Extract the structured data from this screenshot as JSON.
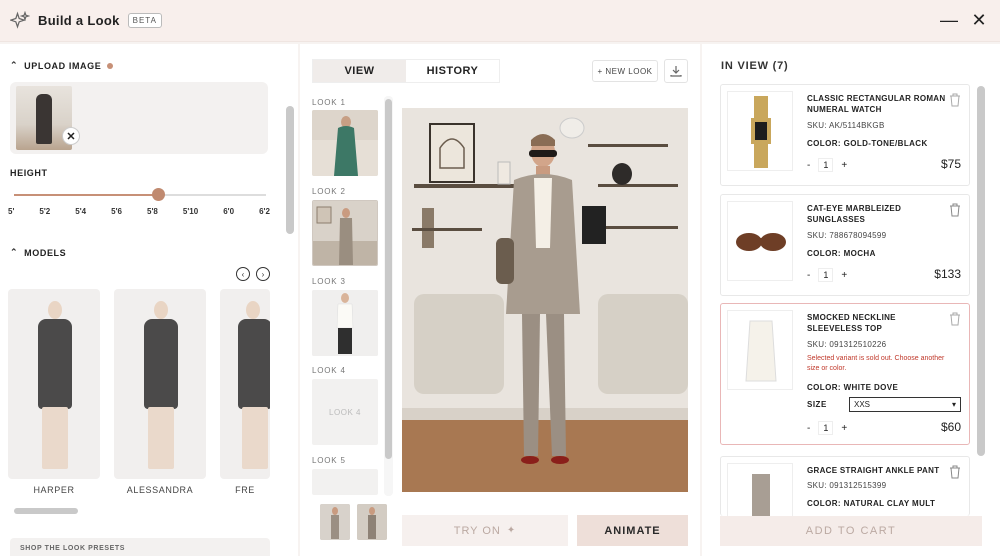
{
  "app": {
    "title": "Build a Look",
    "badge": "BETA"
  },
  "window": {
    "minimize": "—",
    "close": "✕"
  },
  "left": {
    "upload_title": "UPLOAD IMAGE",
    "height_title": "HEIGHT",
    "height_ticks": [
      "5'",
      "5'2",
      "5'4",
      "5'6",
      "5'8",
      "5'10",
      "6'0",
      "6'2"
    ],
    "height_selected": "5'8",
    "height_fraction": 0.57,
    "models_title": "MODELS",
    "models": [
      {
        "name": "HARPER"
      },
      {
        "name": "ALESSANDRA"
      },
      {
        "name": "FRE"
      }
    ],
    "presets_title": "SHOP THE LOOK PRESETS"
  },
  "mid": {
    "tabs": [
      "VIEW",
      "HISTORY"
    ],
    "active_tab": "VIEW",
    "new_look": "+ NEW LOOK",
    "looks": [
      {
        "label": "LOOK 1"
      },
      {
        "label": "LOOK 2"
      },
      {
        "label": "LOOK 3"
      },
      {
        "label": "LOOK 4",
        "placeholder": "LOOK 4"
      },
      {
        "label": "LOOK 5"
      }
    ],
    "try_on": "TRY ON",
    "animate": "ANIMATE"
  },
  "right": {
    "in_view": "IN VIEW (7)",
    "items": [
      {
        "name": "CLASSIC RECTANGULAR ROMAN NUMERAL WATCH",
        "sku": "SKU: AK/5114BKGB",
        "color": "COLOR: GOLD-TONE/BLACK",
        "qty": "1",
        "price": "$75"
      },
      {
        "name": "CAT-EYE MARBLEIZED SUNGLASSES",
        "sku": "SKU: 788678094599",
        "color": "COLOR: MOCHA",
        "qty": "1",
        "price": "$133"
      },
      {
        "name": "SMOCKED NECKLINE SLEEVELESS TOP",
        "sku": "SKU: 091312510226",
        "error": "Selected variant is sold out. Choose another size or color.",
        "color": "COLOR: WHITE DOVE",
        "size_label": "SIZE",
        "size_value": "XXS",
        "qty": "1",
        "price": "$60"
      },
      {
        "name": "GRACE STRAIGHT ANKLE PANT",
        "sku": "SKU: 091312515399",
        "color": "COLOR: NATURAL CLAY MULT"
      }
    ],
    "add_to_cart": "ADD TO CART"
  },
  "colors": {
    "accent": "#c79077",
    "error": "#c0392b",
    "header_bg": "#f8efec"
  },
  "icons": [
    "sparkle-logo-icon",
    "minimize-icon",
    "close-icon",
    "chevron-up-icon",
    "remove-image-icon",
    "chevron-left-icon",
    "chevron-right-icon",
    "download-icon",
    "sparkle-icon",
    "trash-icon",
    "dropdown-arrow-icon"
  ]
}
